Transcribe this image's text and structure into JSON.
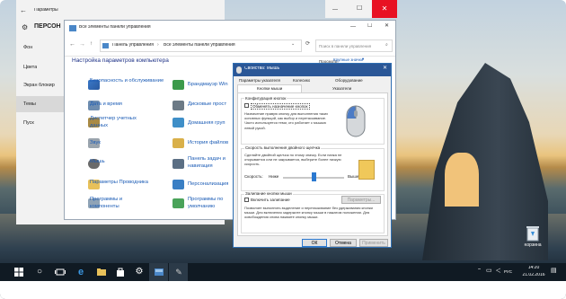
{
  "settings": {
    "title": "Параметры",
    "header": "ПЕРСОН",
    "nav": [
      "Фон",
      "Цвета",
      "Экран блокир",
      "Темы",
      "Пуск"
    ]
  },
  "control_panel": {
    "title": "Все элементы панели управления",
    "breadcrumb": [
      "Панель управления",
      "Все элементы панели управления"
    ],
    "search_placeholder": "Поиск в панели управления",
    "heading": "Настройка параметров компьютера",
    "view_label": "Просмотр:",
    "view_value": "Крупные значки",
    "left_items": [
      "Безопасность и обслуживание",
      "Дата и время",
      "Диспетчер учетных данных",
      "Звук",
      "Мышь",
      "Параметры Проводника",
      "Программы и компоненты"
    ],
    "right_items": [
      "Брандмауэр Win",
      "Дисковые прост",
      "Домашняя груп",
      "История файлов",
      "Панель задач и навигация",
      "Персонализация",
      "Программы по умолчанию"
    ]
  },
  "dialog": {
    "title": "Свойства: Мышь",
    "tabs_row1": [
      "Параметры указателя",
      "Колесико",
      "Оборудование"
    ],
    "tabs_row2": [
      "Кнопки мыши",
      "Указатели"
    ],
    "group1_title": "Конфигурация кнопок",
    "checkbox1": "Обменять назначение кнопок",
    "group1_desc": "Назначение правую кнопку для выполнения таких основных функций, как выбор и перетаскивание. Часто используется теми, кто работает с мышью левой рукой.",
    "group2_title": "Скорость выполнения двойного щелчка",
    "group2_desc": "Сделайте двойной щелчок по этому значку. Если папка не открывается или не закрывается, выберите более низкую скорость.",
    "speed_label": "Скорость:",
    "slow_label": "Ниже",
    "fast_label": "Выше",
    "speed_value": 0.5,
    "group3_title": "Залипание кнопки мыши",
    "checkbox2": "Включить залипание",
    "settings_button": "Параметры...",
    "group3_desc": "Позволяет выполнять выделение и перетаскивание без удерживания кнопки мыши. Для включения задержите кнопку мыши в нажатом положении. Для освобождения снова нажмите кнопку мыши.",
    "ok": "ОК",
    "cancel": "Отмена",
    "apply": "Применить"
  },
  "desktop": {
    "recycle_label": "Корзина"
  },
  "taskbar": {
    "time": "14:20",
    "date": "21.02.2016",
    "lang": "РУС"
  },
  "colors": {
    "accent": "#2b5797",
    "link": "#0066cc",
    "taskbar": "#101a23"
  }
}
